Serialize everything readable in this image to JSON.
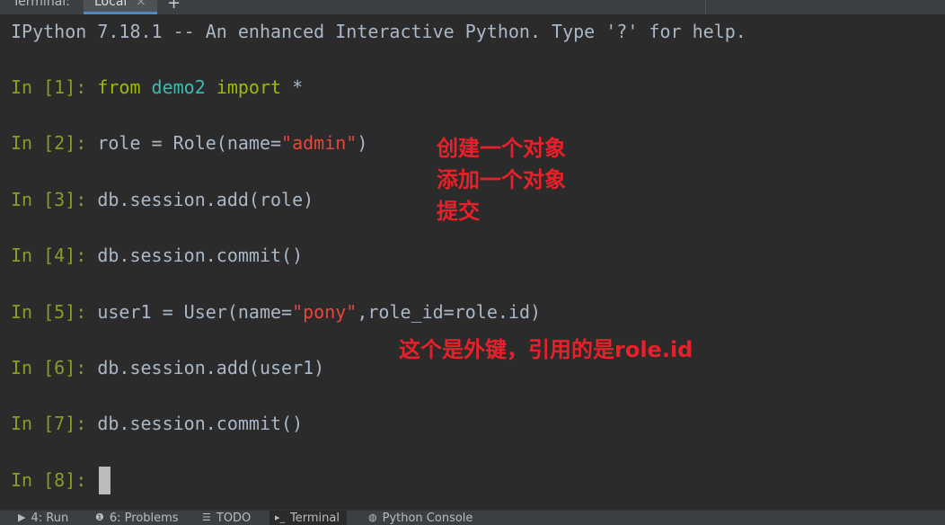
{
  "topbar": {
    "label": "Terminal:",
    "tab_label": "Local",
    "tab_close": "×",
    "add_tab": "+"
  },
  "terminal": {
    "banner": "IPython 7.18.1 -- An enhanced Interactive Python. Type '?' for help.",
    "cells": [
      {
        "prompt": "In [1]: ",
        "code_parts": [
          {
            "t": "from",
            "c": "kw"
          },
          {
            "t": " ",
            "c": ""
          },
          {
            "t": "demo2",
            "c": "mod"
          },
          {
            "t": " ",
            "c": ""
          },
          {
            "t": "import",
            "c": "kw"
          },
          {
            "t": " *",
            "c": ""
          }
        ]
      },
      {
        "prompt": "In [2]: ",
        "code_parts": [
          {
            "t": "role = Role(name=",
            "c": ""
          },
          {
            "t": "\"admin\"",
            "c": "str"
          },
          {
            "t": ")",
            "c": ""
          }
        ]
      },
      {
        "prompt": "In [3]: ",
        "code_parts": [
          {
            "t": "db.session.add(role)",
            "c": ""
          }
        ]
      },
      {
        "prompt": "In [4]: ",
        "code_parts": [
          {
            "t": "db.session.commit()",
            "c": ""
          }
        ]
      },
      {
        "prompt": "In [5]: ",
        "code_parts": [
          {
            "t": "user1 = User(name=",
            "c": ""
          },
          {
            "t": "\"pony\"",
            "c": "str"
          },
          {
            "t": ",role_id=role.id)",
            "c": ""
          }
        ]
      },
      {
        "prompt": "In [6]: ",
        "code_parts": [
          {
            "t": "db.session.add(user1)",
            "c": ""
          }
        ]
      },
      {
        "prompt": "In [7]: ",
        "code_parts": [
          {
            "t": "db.session.commit()",
            "c": ""
          }
        ]
      },
      {
        "prompt": "In [8]: ",
        "code_parts": []
      }
    ]
  },
  "annotations": {
    "note1_line1": "创建一个对象",
    "note1_line2": "添加一个对象",
    "note1_line3": "提交",
    "note2": "这个是外键，引用的是role.id"
  },
  "bottombar": {
    "items": [
      {
        "icon": "▶",
        "label": "4: Run"
      },
      {
        "icon": "❶",
        "label": "6: Problems"
      },
      {
        "icon": "☰",
        "label": "TODO"
      },
      {
        "icon": "▸_",
        "label": "Terminal"
      },
      {
        "icon": "◍",
        "label": "Python Console"
      }
    ]
  },
  "colors": {
    "background": "#2b2b2b",
    "prompt": "#8c9a2b",
    "keyword": "#a0b80c",
    "module": "#3dbbb0",
    "string": "#e8463c",
    "annotation": "#e8202a"
  }
}
